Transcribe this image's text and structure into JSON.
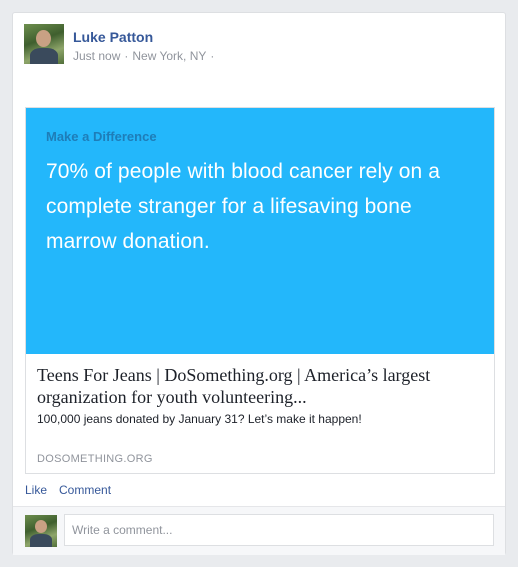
{
  "post": {
    "author": "Luke Patton",
    "time": "Just now",
    "location": "New York, NY",
    "separator": "·"
  },
  "link": {
    "hero_kicker": "Make a Difference",
    "hero_headline": "70% of people with blood cancer rely on a complete stranger for a lifesaving bone marrow donation.",
    "title": "Teens For Jeans | DoSomething.org | America’s largest organization for youth volunteering...",
    "description": "100,000 jeans donated by January 31? Let’s make it happen!",
    "domain": "DOSOMETHING.ORG",
    "hero_color": "#23b7fb"
  },
  "actions": {
    "like": "Like",
    "comment": "Comment"
  },
  "comment_box": {
    "placeholder": "Write a comment..."
  },
  "icons": {
    "privacy": "globe-icon",
    "avatar": "profile-photo"
  }
}
